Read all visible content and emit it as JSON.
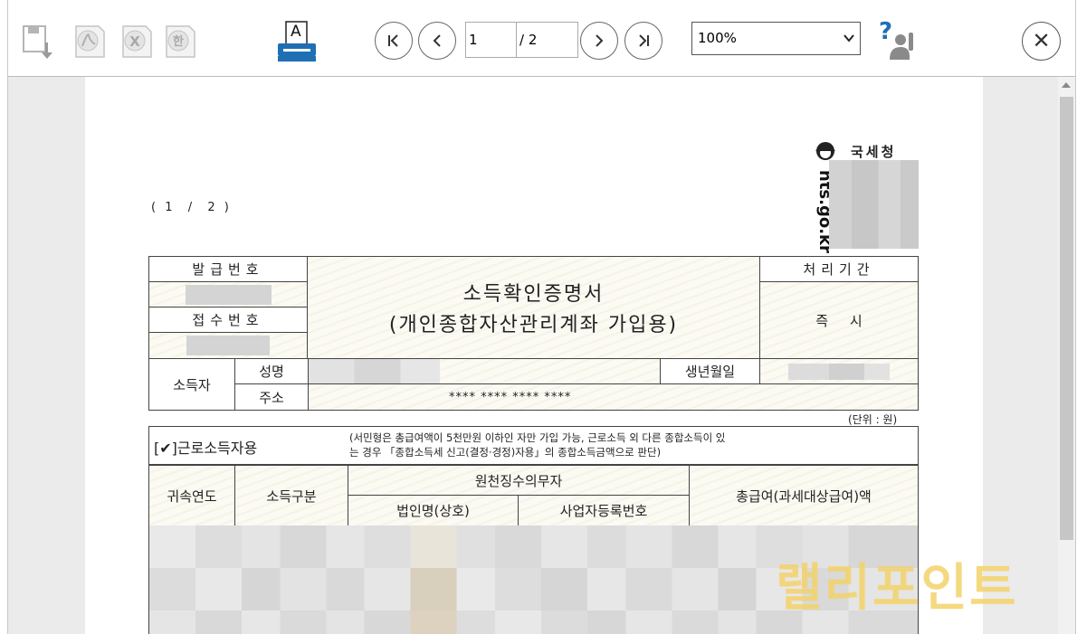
{
  "toolbar": {
    "page_current": "1",
    "page_total": "/ 2",
    "zoom_value": "100%",
    "zoom_arrow": "⌄",
    "close_glyph": "✕",
    "print_label": "A",
    "help_glyph": "?"
  },
  "document": {
    "page_indicator": "( 1  /  2 )",
    "agency_name": "국세청",
    "agency_url": "nts.go.kr",
    "issue_no_label": "발급번호",
    "receipt_no_label": "접수번호",
    "title_line1": "소득확인증명서",
    "title_line2": "(개인종합자산관리계좌 가입용)",
    "processing_label": "처리기간",
    "processing_value": "즉     시",
    "earner_label": "소득자",
    "name_label": "성명",
    "address_label": "주소",
    "dob_label": "생년월일",
    "address_value": "**** **** **** ****",
    "unit_note": "(단위 : 원)",
    "usage_check": "[✔]근로소득자용",
    "usage_note_line1": "(서민형은 총급여액이 5천만원 이하인 자만 가입 가능, 근로소득 외 다른 종합소득이 있",
    "usage_note_line2": "는 경우 「종합소득세 신고(결정·경정)자용」의 종합소득금액으로 판단)",
    "col_year": "귀속연도",
    "col_income_type": "소득구분",
    "col_withholder": "원천징수의무자",
    "col_corp_name": "법인명(상호)",
    "col_biz_no": "사업자등록번호",
    "col_total_pay": "총급여(과세대상급여)액"
  },
  "watermark_text": "랠리포인트",
  "colors": {
    "print_blue": "#1f6fb5",
    "watermark": "#f4d36a",
    "disabled_icon": "#b5b5b5"
  }
}
